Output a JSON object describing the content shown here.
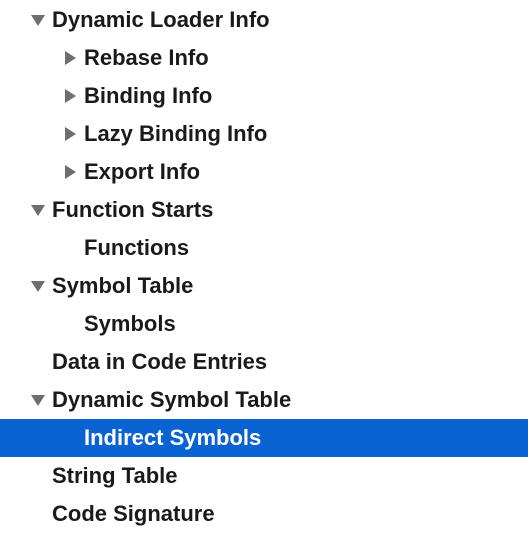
{
  "outline": {
    "rows": [
      {
        "label": "Dynamic Loader Info",
        "level": 0,
        "disclosure": "expanded",
        "selected": false
      },
      {
        "label": "Rebase Info",
        "level": 1,
        "disclosure": "collapsed",
        "selected": false
      },
      {
        "label": "Binding Info",
        "level": 1,
        "disclosure": "collapsed",
        "selected": false
      },
      {
        "label": "Lazy Binding Info",
        "level": 1,
        "disclosure": "collapsed",
        "selected": false
      },
      {
        "label": "Export Info",
        "level": 1,
        "disclosure": "collapsed",
        "selected": false
      },
      {
        "label": "Function Starts",
        "level": 0,
        "disclosure": "expanded",
        "selected": false
      },
      {
        "label": "Functions",
        "level": 1,
        "disclosure": "none",
        "selected": false
      },
      {
        "label": "Symbol Table",
        "level": 0,
        "disclosure": "expanded",
        "selected": false
      },
      {
        "label": "Symbols",
        "level": 1,
        "disclosure": "none",
        "selected": false
      },
      {
        "label": "Data in Code Entries",
        "level": 0,
        "disclosure": "none",
        "selected": false
      },
      {
        "label": "Dynamic Symbol Table",
        "level": 0,
        "disclosure": "expanded",
        "selected": false
      },
      {
        "label": "Indirect Symbols",
        "level": 1,
        "disclosure": "none",
        "selected": true
      },
      {
        "label": "String Table",
        "level": 0,
        "disclosure": "none",
        "selected": false
      },
      {
        "label": "Code Signature",
        "level": 0,
        "disclosure": "none",
        "selected": false
      }
    ]
  },
  "colors": {
    "selection": "#0a63d3",
    "text": "#1a1a1a",
    "selected_text": "#ffffff",
    "disclosure": "#6e6e6e"
  }
}
